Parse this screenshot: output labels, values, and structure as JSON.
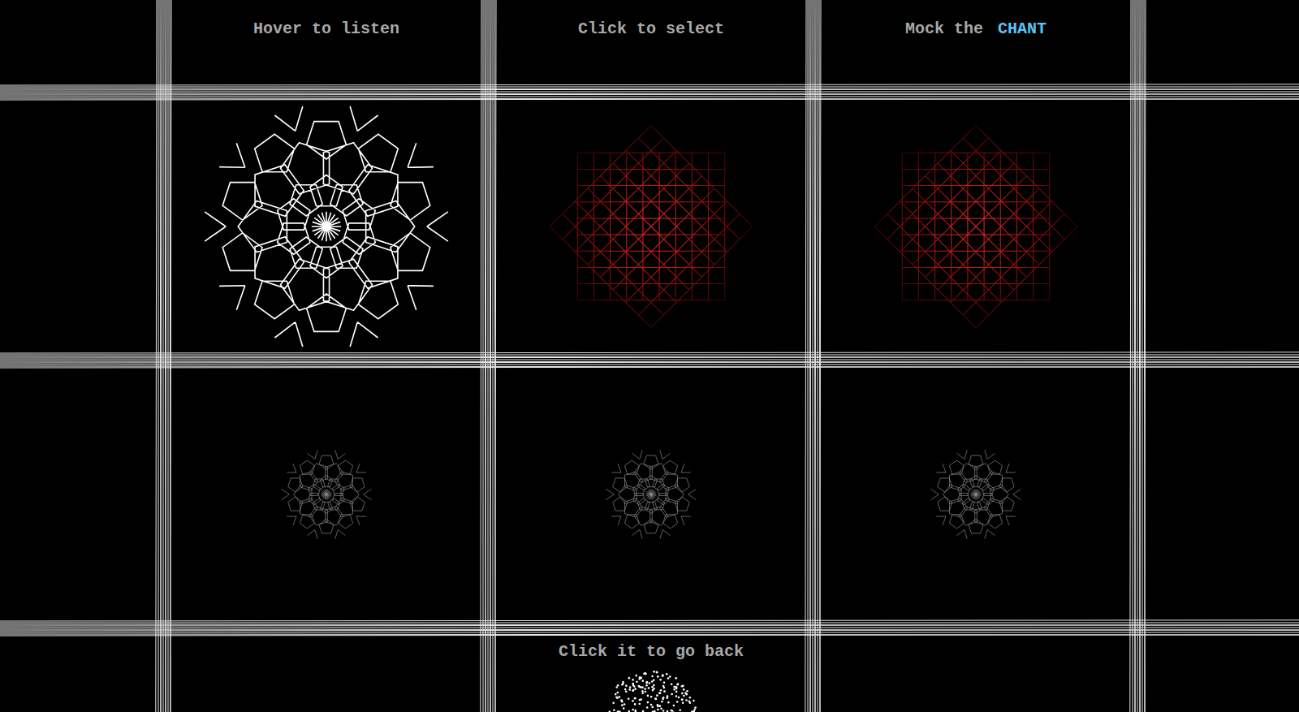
{
  "columns": [
    {
      "header": "Hover to listen"
    },
    {
      "header": "Click to select"
    },
    {
      "header": "Mock the",
      "highlight": "CHANT"
    }
  ],
  "rows": [
    [
      {
        "kind": "star",
        "active": true
      },
      {
        "kind": "grid",
        "active": false
      },
      {
        "kind": "grid",
        "active": false
      }
    ],
    [
      {
        "kind": "star",
        "active": false
      },
      {
        "kind": "star",
        "active": false
      },
      {
        "kind": "star",
        "active": false
      }
    ]
  ],
  "footer": {
    "label": "Click it to go back"
  }
}
